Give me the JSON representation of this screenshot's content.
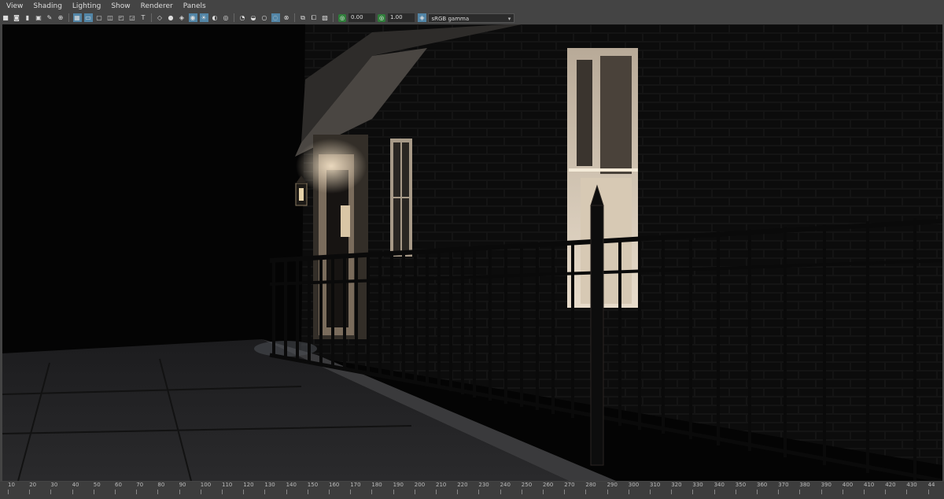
{
  "menubar": {
    "items": [
      "View",
      "Shading",
      "Lighting",
      "Show",
      "Renderer",
      "Panels"
    ]
  },
  "toolbar": {
    "icons_a": [
      "camera-icon",
      "camera-attributes-icon",
      "bookmark-icon",
      "image-plane-icon",
      "grease-pencil-icon",
      "2d-pan-zoom-icon"
    ],
    "icons_b": [
      "grid-icon",
      "film-gate-icon",
      "resolution-gate-icon",
      "gate-mask-icon",
      "field-chart-icon",
      "safe-action-icon",
      "safe-title-icon"
    ],
    "icons_c": [
      "wireframe-icon",
      "smooth-shade-icon",
      "wireframe-on-shaded-icon",
      "textured-icon",
      "use-all-lights-icon",
      "shadows-icon",
      "screen-space-ao-icon"
    ],
    "icons_d": [
      "motion-blur-icon",
      "multisample-aa-icon",
      "depth-of-field-icon",
      "xray-icon",
      "xray-joints-icon"
    ],
    "icons_e": [
      "isolate-select-icon",
      "xray-components-icon",
      "tone-map-icon"
    ],
    "exposure_value": "0.00",
    "gamma_value": "1.00",
    "color_space": "sRGB gamma"
  },
  "timeline": {
    "ticks": [
      "10",
      "20",
      "30",
      "40",
      "50",
      "60",
      "70",
      "80",
      "90",
      "100",
      "110",
      "120",
      "130",
      "140",
      "150",
      "160",
      "170",
      "180",
      "190",
      "200",
      "210",
      "220",
      "230",
      "240",
      "250",
      "260",
      "270",
      "280",
      "290",
      "300",
      "310",
      "320",
      "330",
      "340",
      "350",
      "360",
      "370",
      "380",
      "390",
      "400",
      "410",
      "420",
      "430",
      "44"
    ]
  }
}
